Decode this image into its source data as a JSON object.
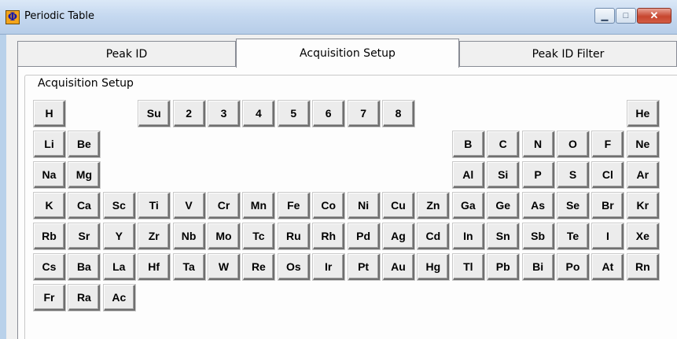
{
  "window": {
    "title": "Periodic Table",
    "icon_glyph": "Φ",
    "minimize_glyph": "▁",
    "maximize_glyph": "□",
    "close_glyph": "✕"
  },
  "tabs": [
    {
      "label": "Peak ID",
      "active": false
    },
    {
      "label": "Acquisition Setup",
      "active": true
    },
    {
      "label": "Peak ID Filter",
      "active": false
    }
  ],
  "group_label": "Acquisition Setup",
  "rows": [
    [
      [
        0,
        "H"
      ],
      [
        3,
        "Su"
      ],
      [
        4,
        "2"
      ],
      [
        5,
        "3"
      ],
      [
        6,
        "4"
      ],
      [
        7,
        "5"
      ],
      [
        8,
        "6"
      ],
      [
        9,
        "7"
      ],
      [
        10,
        "8"
      ],
      [
        17,
        "He"
      ]
    ],
    [
      [
        0,
        "Li"
      ],
      [
        1,
        "Be"
      ],
      [
        12,
        "B"
      ],
      [
        13,
        "C"
      ],
      [
        14,
        "N"
      ],
      [
        15,
        "O"
      ],
      [
        16,
        "F"
      ],
      [
        17,
        "Ne"
      ]
    ],
    [
      [
        0,
        "Na"
      ],
      [
        1,
        "Mg"
      ],
      [
        12,
        "Al"
      ],
      [
        13,
        "Si"
      ],
      [
        14,
        "P"
      ],
      [
        15,
        "S"
      ],
      [
        16,
        "Cl"
      ],
      [
        17,
        "Ar"
      ]
    ],
    [
      [
        0,
        "K"
      ],
      [
        1,
        "Ca"
      ],
      [
        2,
        "Sc"
      ],
      [
        3,
        "Ti"
      ],
      [
        4,
        "V"
      ],
      [
        5,
        "Cr"
      ],
      [
        6,
        "Mn"
      ],
      [
        7,
        "Fe"
      ],
      [
        8,
        "Co"
      ],
      [
        9,
        "Ni"
      ],
      [
        10,
        "Cu"
      ],
      [
        11,
        "Zn"
      ],
      [
        12,
        "Ga"
      ],
      [
        13,
        "Ge"
      ],
      [
        14,
        "As"
      ],
      [
        15,
        "Se"
      ],
      [
        16,
        "Br"
      ],
      [
        17,
        "Kr"
      ]
    ],
    [
      [
        0,
        "Rb"
      ],
      [
        1,
        "Sr"
      ],
      [
        2,
        "Y"
      ],
      [
        3,
        "Zr"
      ],
      [
        4,
        "Nb"
      ],
      [
        5,
        "Mo"
      ],
      [
        6,
        "Tc"
      ],
      [
        7,
        "Ru"
      ],
      [
        8,
        "Rh"
      ],
      [
        9,
        "Pd"
      ],
      [
        10,
        "Ag"
      ],
      [
        11,
        "Cd"
      ],
      [
        12,
        "In"
      ],
      [
        13,
        "Sn"
      ],
      [
        14,
        "Sb"
      ],
      [
        15,
        "Te"
      ],
      [
        16,
        "I"
      ],
      [
        17,
        "Xe"
      ]
    ],
    [
      [
        0,
        "Cs"
      ],
      [
        1,
        "Ba"
      ],
      [
        2,
        "La"
      ],
      [
        3,
        "Hf"
      ],
      [
        4,
        "Ta"
      ],
      [
        5,
        "W"
      ],
      [
        6,
        "Re"
      ],
      [
        7,
        "Os"
      ],
      [
        8,
        "Ir"
      ],
      [
        9,
        "Pt"
      ],
      [
        10,
        "Au"
      ],
      [
        11,
        "Hg"
      ],
      [
        12,
        "Tl"
      ],
      [
        13,
        "Pb"
      ],
      [
        14,
        "Bi"
      ],
      [
        15,
        "Po"
      ],
      [
        16,
        "At"
      ],
      [
        17,
        "Rn"
      ]
    ],
    [
      [
        0,
        "Fr"
      ],
      [
        1,
        "Ra"
      ],
      [
        2,
        "Ac"
      ]
    ]
  ]
}
